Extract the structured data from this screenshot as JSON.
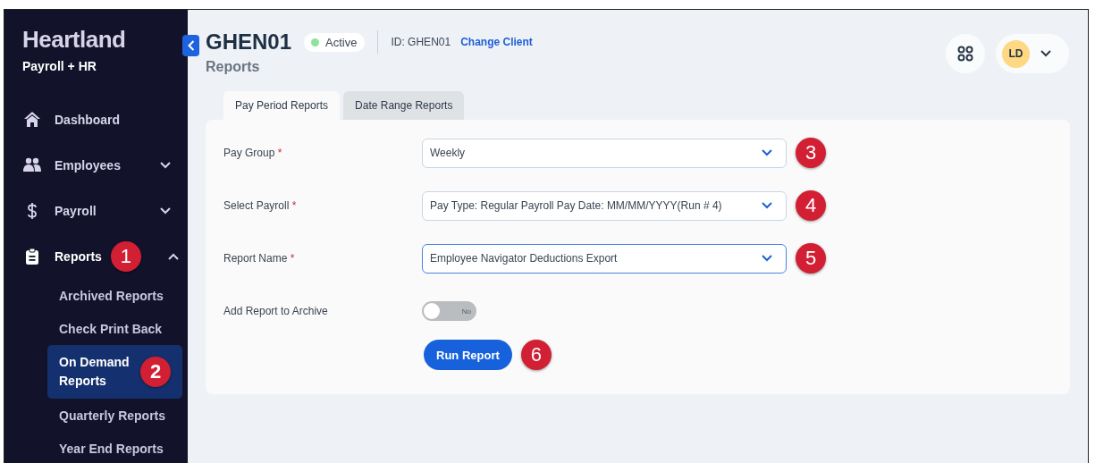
{
  "sidebar": {
    "brand": "Heartland",
    "subtitle": "Payroll + HR",
    "items": [
      {
        "label": "Dashboard",
        "kind": "link"
      },
      {
        "label": "Employees",
        "kind": "group",
        "expanded": false
      },
      {
        "label": "Payroll",
        "kind": "group",
        "expanded": false
      },
      {
        "label": "Reports",
        "kind": "group",
        "expanded": true,
        "callout": "1",
        "children": [
          {
            "label": "Archived Reports",
            "selected": false
          },
          {
            "label": "Check Print Back",
            "selected": false
          },
          {
            "label": "On Demand Reports",
            "selected": true,
            "callout": "2"
          },
          {
            "label": "Quarterly Reports",
            "selected": false
          },
          {
            "label": "Year End Reports",
            "selected": false
          }
        ]
      }
    ]
  },
  "header": {
    "title": "GHEN01",
    "status": "Active",
    "client_id": "ID: GHEN01",
    "change_client": "Change Client",
    "subtitle": "Reports",
    "user_initials": "LD"
  },
  "tabs": [
    {
      "label": "Pay Period Reports",
      "selected": true
    },
    {
      "label": "Date Range Reports",
      "selected": false
    }
  ],
  "form": {
    "fields": [
      {
        "kind": "select",
        "label": "Pay Group",
        "required_mark": "*",
        "value": "Weekly",
        "focused": false,
        "callout": "3"
      },
      {
        "kind": "select",
        "label": "Select Payroll",
        "required_mark": "*",
        "value": "Pay Type: Regular Payroll Pay Date: MM/MM/YYYY(Run # 4)",
        "focused": false,
        "callout": "4"
      },
      {
        "kind": "select",
        "label": "Report Name",
        "required_mark": "*",
        "value": "Employee Navigator Deductions Export",
        "focused": true,
        "callout": "5"
      },
      {
        "kind": "toggle",
        "label": "Add Report to Archive",
        "on": false,
        "value": "No"
      }
    ],
    "button": {
      "label": "Run Report",
      "callout": "6"
    }
  }
}
